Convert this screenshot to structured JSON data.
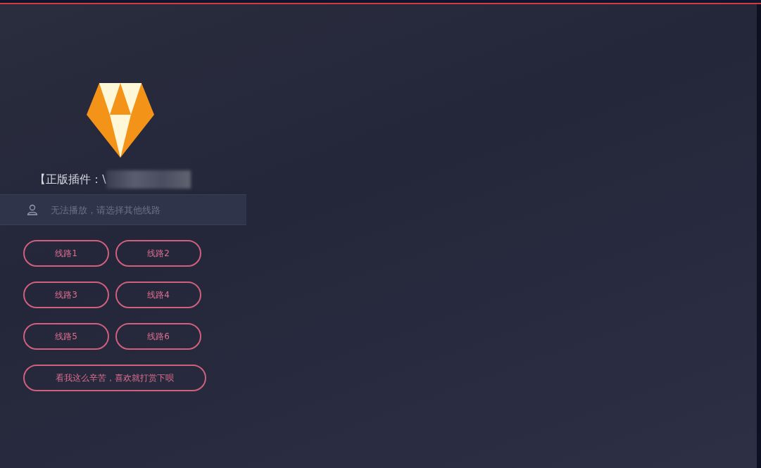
{
  "title": "【正版插件：\\",
  "input": {
    "placeholder": "无法播放，请选择其他线路"
  },
  "routes": [
    {
      "label": "线路1"
    },
    {
      "label": "线路2"
    },
    {
      "label": "线路3"
    },
    {
      "label": "线路4"
    },
    {
      "label": "线路5"
    },
    {
      "label": "线路6"
    }
  ],
  "reward_button": "看我这么辛苦，喜欢就打赏下呗"
}
